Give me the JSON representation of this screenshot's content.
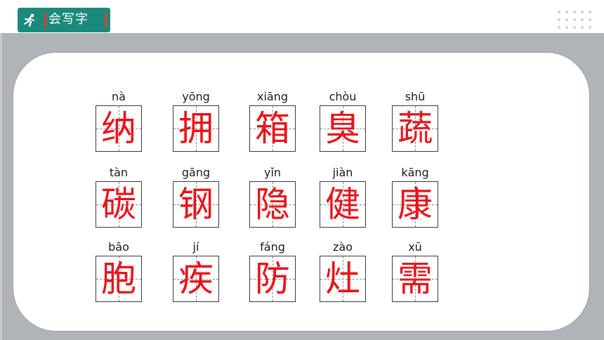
{
  "header": {
    "section_title": "会写字",
    "icon": "running-figure-icon"
  },
  "colors": {
    "accent": "#1b8a7c",
    "character": "#e8141c",
    "marker": "#e23b2f"
  },
  "rows": [
    [
      {
        "pinyin": "nà",
        "char": "纳"
      },
      {
        "pinyin": "yōng",
        "char": "拥"
      },
      {
        "pinyin": "xiāng",
        "char": "箱"
      },
      {
        "pinyin": "chòu",
        "char": "臭"
      },
      {
        "pinyin": "shū",
        "char": "蔬"
      }
    ],
    [
      {
        "pinyin": "tàn",
        "char": "碳"
      },
      {
        "pinyin": "gāng",
        "char": "钢"
      },
      {
        "pinyin": "yǐn",
        "char": "隐"
      },
      {
        "pinyin": "jiàn",
        "char": "健"
      },
      {
        "pinyin": "kāng",
        "char": "康"
      }
    ],
    [
      {
        "pinyin": "bāo",
        "char": "胞"
      },
      {
        "pinyin": "jí",
        "char": "疾"
      },
      {
        "pinyin": "fáng",
        "char": "防"
      },
      {
        "pinyin": "zào",
        "char": "灶"
      },
      {
        "pinyin": "xū",
        "char": "需"
      }
    ]
  ]
}
